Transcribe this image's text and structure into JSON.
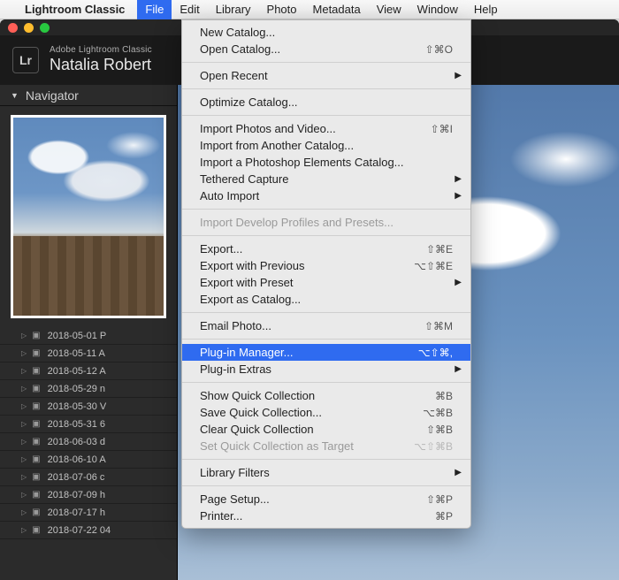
{
  "menubar": {
    "app": "Lightroom Classic",
    "items": [
      "File",
      "Edit",
      "Library",
      "Photo",
      "Metadata",
      "View",
      "Window",
      "Help"
    ],
    "active_index": 0
  },
  "window": {
    "product": "Adobe Lightroom Classic",
    "subtitle": "Natalia Robert"
  },
  "navigator": {
    "title": "Navigator"
  },
  "folders": [
    "2018-05-01 P",
    "2018-05-11 A",
    "2018-05-12 A",
    "2018-05-29 n",
    "2018-05-30 V",
    "2018-05-31 6",
    "2018-06-03 d",
    "2018-06-10 A",
    "2018-07-06 c",
    "2018-07-09 h",
    "2018-07-17 h",
    "2018-07-22 04"
  ],
  "file_menu": {
    "groups": [
      [
        {
          "label": "New Catalog..."
        },
        {
          "label": "Open Catalog...",
          "shortcut": "⇧⌘O"
        }
      ],
      [
        {
          "label": "Open Recent",
          "submenu": true
        }
      ],
      [
        {
          "label": "Optimize Catalog..."
        }
      ],
      [
        {
          "label": "Import Photos and Video...",
          "shortcut": "⇧⌘I"
        },
        {
          "label": "Import from Another Catalog..."
        },
        {
          "label": "Import a Photoshop Elements Catalog..."
        },
        {
          "label": "Tethered Capture",
          "submenu": true
        },
        {
          "label": "Auto Import",
          "submenu": true
        }
      ],
      [
        {
          "label": "Import Develop Profiles and Presets...",
          "disabled": true
        }
      ],
      [
        {
          "label": "Export...",
          "shortcut": "⇧⌘E"
        },
        {
          "label": "Export with Previous",
          "shortcut": "⌥⇧⌘E"
        },
        {
          "label": "Export with Preset",
          "submenu": true
        },
        {
          "label": "Export as Catalog..."
        }
      ],
      [
        {
          "label": "Email Photo...",
          "shortcut": "⇧⌘M"
        }
      ],
      [
        {
          "label": "Plug-in Manager...",
          "shortcut": "⌥⇧⌘,",
          "highlight": true
        },
        {
          "label": "Plug-in Extras",
          "submenu": true
        }
      ],
      [
        {
          "label": "Show Quick Collection",
          "shortcut": "⌘B"
        },
        {
          "label": "Save Quick Collection...",
          "shortcut": "⌥⌘B"
        },
        {
          "label": "Clear Quick Collection",
          "shortcut": "⇧⌘B"
        },
        {
          "label": "Set Quick Collection as Target",
          "shortcut": "⌥⇧⌘B",
          "disabled": true
        }
      ],
      [
        {
          "label": "Library Filters",
          "submenu": true
        }
      ],
      [
        {
          "label": "Page Setup...",
          "shortcut": "⇧⌘P"
        },
        {
          "label": "Printer...",
          "shortcut": "⌘P"
        }
      ]
    ]
  }
}
